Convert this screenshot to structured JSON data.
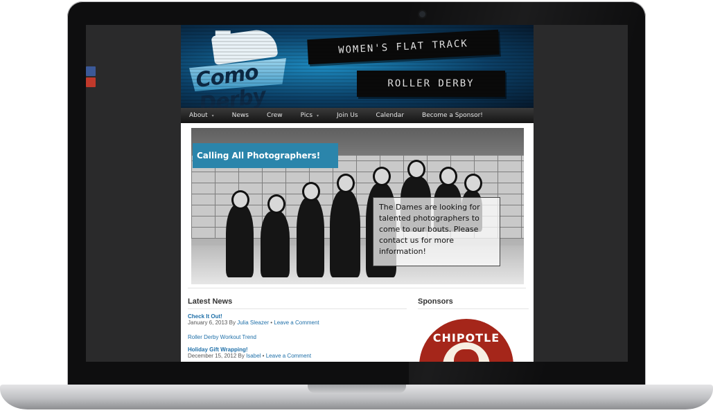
{
  "site": {
    "logo_text": "Como Derby Dames",
    "banner_line1": "WOMEN'S FLAT TRACK",
    "banner_line2": "ROLLER DERBY"
  },
  "nav": {
    "items": [
      {
        "label": "About",
        "has_submenu": true
      },
      {
        "label": "News",
        "has_submenu": false
      },
      {
        "label": "Crew",
        "has_submenu": false
      },
      {
        "label": "Pics",
        "has_submenu": true
      },
      {
        "label": "Join Us",
        "has_submenu": false
      },
      {
        "label": "Calendar",
        "has_submenu": false
      },
      {
        "label": "Become a Sponsor!",
        "has_submenu": false
      }
    ]
  },
  "slider": {
    "title": "Calling All Photographers!",
    "text": "The Dames are looking for talented photographers to come to our bouts.  Please contact us for more information!"
  },
  "latest_news": {
    "heading": "Latest News",
    "posts": [
      {
        "title": "Check It Out!",
        "date": "January 6, 2013",
        "by": "By",
        "author": "Julia Sleazer",
        "sep": "•",
        "comment": "Leave a Comment"
      },
      {
        "link": "Roller Derby Workout Trend"
      },
      {
        "title": "Holiday Gift Wrapping!",
        "date": "December 15, 2012",
        "by": "By",
        "author": "Isabel",
        "sep": "•",
        "comment": "Leave a Comment"
      }
    ]
  },
  "sponsors": {
    "heading": "Sponsors",
    "sponsor_name": "CHIPOTLE"
  },
  "social": {
    "icons": [
      "facebook-icon",
      "youtube-icon"
    ]
  },
  "colors": {
    "accent_blue": "#2b85ab",
    "link_blue": "#1e6fa8",
    "sponsor_red": "#a5261a"
  }
}
